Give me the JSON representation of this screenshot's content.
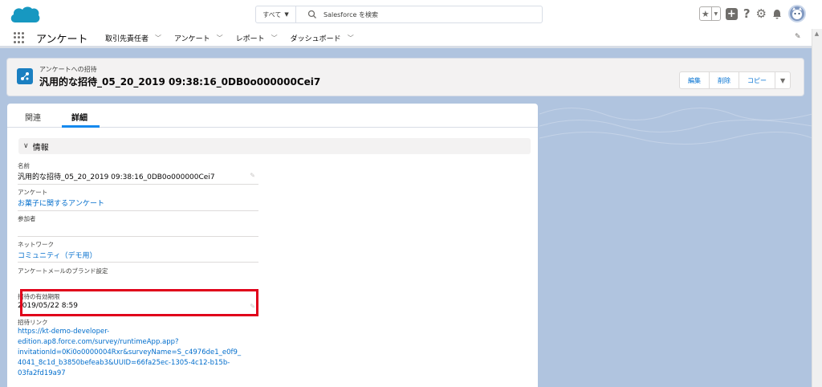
{
  "header": {
    "search_scope": "すべて",
    "search_placeholder": "Salesforce を検索"
  },
  "nav": {
    "app_name": "アンケート",
    "items": [
      {
        "label": "取引先責任者"
      },
      {
        "label": "アンケート"
      },
      {
        "label": "レポート"
      },
      {
        "label": "ダッシュボード"
      }
    ]
  },
  "record": {
    "type_label": "アンケートへの招待",
    "title": "汎用的な招待_05_20_2019 09:38:16_0DB0o000000Cei7",
    "actions": {
      "edit": "編集",
      "delete": "削除",
      "copy": "コピー"
    }
  },
  "tabs": {
    "related": "関連",
    "detail": "詳細"
  },
  "section": {
    "title": "情報"
  },
  "fields": {
    "name_label": "名前",
    "name_value": "汎用的な招待_05_20_2019 09:38:16_0DB0o000000Cei7",
    "survey_label": "アンケート",
    "survey_value": "お菓子に関するアンケート",
    "participant_label": "参加者",
    "network_label": "ネットワーク",
    "network_value": "コミュニティ（デモ用）",
    "brand_label": "アンケートメールのブランド設定",
    "expiry_label": "招待の有効期限",
    "expiry_value": "2019/05/22 8:59",
    "link_label": "招待リンク",
    "link_lines": [
      "https://kt-demo-developer-",
      "edition.ap8.force.com/survey/runtimeApp.app?",
      "invitationId=0Ki0o0000004Rxr&surveyName=S_c4976de1_e0f9_",
      "4041_8c1d_b3850befeab3&UUID=66fa25ec-1305-4c12-b15b-",
      "03fa2fd19a97"
    ]
  },
  "colors": {
    "brand_blue": "#1589ee",
    "link": "#006dcc",
    "highlight": "#e0001a",
    "page_bg": "#b0c4df"
  }
}
